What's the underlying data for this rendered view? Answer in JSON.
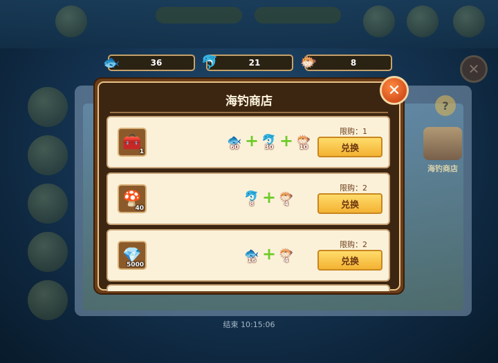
{
  "resources": [
    {
      "icon": "gold-fish-icon",
      "glyph": "🐟",
      "value": "36"
    },
    {
      "icon": "blue-fish-icon",
      "glyph": "🐬",
      "value": "21"
    },
    {
      "icon": "purple-fish-icon",
      "glyph": "🐡",
      "value": "8"
    }
  ],
  "dialog": {
    "title": "海钓商店",
    "close_glyph": "✕",
    "exchange_label": "兑换",
    "rows": [
      {
        "item_icon": "gold-chest-icon",
        "item_glyph": "🧰",
        "item_qty": "1",
        "limit": "限购：1",
        "costs": [
          {
            "icon": "gold-fish-icon",
            "glyph": "🐟",
            "qty": "60"
          },
          {
            "icon": "blue-fish-icon",
            "glyph": "🐬",
            "qty": "30"
          },
          {
            "icon": "purple-fish-icon",
            "glyph": "🐡",
            "qty": "10"
          }
        ]
      },
      {
        "item_icon": "mushroom-icon",
        "item_glyph": "🍄",
        "item_qty": "40",
        "limit": "限购：2",
        "costs": [
          {
            "icon": "blue-fish-icon",
            "glyph": "🐬",
            "qty": "8"
          },
          {
            "icon": "purple-fish-icon",
            "glyph": "🐡",
            "qty": "4"
          }
        ]
      },
      {
        "item_icon": "diamond-icon",
        "item_glyph": "💎",
        "item_qty": "5000",
        "limit": "限购：2",
        "costs": [
          {
            "icon": "gold-fish-icon",
            "glyph": "🐟",
            "qty": "16"
          },
          {
            "icon": "purple-fish-icon",
            "glyph": "🐡",
            "qty": "4"
          }
        ]
      }
    ]
  },
  "background": {
    "shop_label": "海钓商店",
    "end_time": "结束 10:15:06",
    "help_glyph": "?",
    "close_glyph": "✕"
  }
}
